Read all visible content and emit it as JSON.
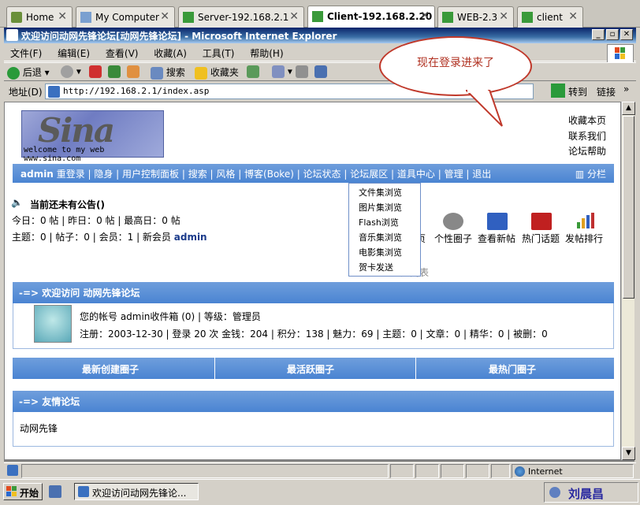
{
  "vm_tabs": [
    {
      "label": "Home",
      "icon": "home-icon"
    },
    {
      "label": "My Computer",
      "icon": "computer-icon"
    },
    {
      "label": "Server-192.168.2.1",
      "icon": "vm-play-icon"
    },
    {
      "label": "Client-192.168.2.20",
      "icon": "vm-play-icon"
    },
    {
      "label": "WEB-2.3",
      "icon": "vm-play-icon"
    },
    {
      "label": "client",
      "icon": "vm-play-icon"
    }
  ],
  "window": {
    "title": "欢迎访问动网先锋论坛[动网先锋论坛] - Microsoft Internet Explorer"
  },
  "menubar": [
    "文件(F)",
    "编辑(E)",
    "查看(V)",
    "收藏(A)",
    "工具(T)",
    "帮助(H)"
  ],
  "toolbar": {
    "back": "后退",
    "search": "搜索",
    "favorites": "收藏夹"
  },
  "address": {
    "label": "地址(D)",
    "url": "http://192.168.2.1/index.asp",
    "go": "转到",
    "links": "链接"
  },
  "callout": "现在登录进来了",
  "page": {
    "logo_text": "Sina",
    "logo_sub": "welcome to my web www.sina.com",
    "right_links": [
      "收藏本页",
      "联系我们",
      "论坛帮助"
    ],
    "nav": {
      "user": "admin",
      "items": "重登录 | 隐身 | 用户控制面板 | 搜索 | 风格 | 博客(Boke) | 论坛状态 | 论坛展区 | 道具中心 | 管理 | 退出",
      "split": "分栏"
    },
    "dropdown": [
      "文件集浏览",
      "图片集浏览",
      "Flash浏览",
      "音乐集浏览",
      "电影集浏览",
      "贺卡发送"
    ],
    "announcement": "当前还未有公告()",
    "stats_line1": "今日：0 帖 | 昨日：0 帖 | 最高日：0 帖",
    "stats_line2_prefix": "主题：0 | 帖子：0 | 会员：1 | 新会员 ",
    "stats_new_member": "admin",
    "quick_links": [
      {
        "label": "主页",
        "icon": "home-icon"
      },
      {
        "label": "个性圈子",
        "icon": "people-icon"
      },
      {
        "label": "查看新帖",
        "icon": "new-icon"
      },
      {
        "label": "热门话题",
        "icon": "hot-icon"
      },
      {
        "label": "发帖排行",
        "icon": "chart-icon"
      }
    ],
    "user_list_label": "用户列表",
    "welcome_head": "-=> 欢迎访问 动网先锋论坛",
    "account_line": "您的帐号 admin收件箱 (0) | 等级：管理员",
    "account_detail": "注册：2003-12-30 | 登录 20 次 金钱：204 | 积分：138 | 魅力：69 | 主题：0 | 文章：0 | 精华：0 | 被删：0",
    "circle_tabs": [
      "最新创建圈子",
      "最活跃圈子",
      "最热门圈子"
    ],
    "friends_head": "-=> 友情论坛",
    "friends_item": "动网先锋"
  },
  "status": {
    "zone": "Internet"
  },
  "taskbar": {
    "start": "开始",
    "item": "欢迎访问动网先锋论...",
    "user": "刘晨昌"
  },
  "colors": {
    "nav_blue": "#4a84d2",
    "title_blue": "#0a246a",
    "accent_red": "#c00000"
  }
}
